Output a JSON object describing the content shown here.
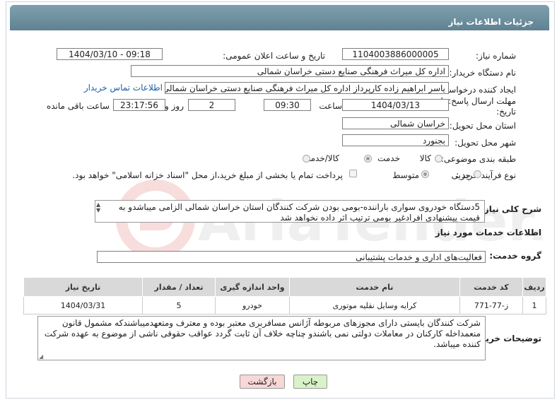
{
  "header": {
    "title": "جزئیات اطلاعات نیاز"
  },
  "form": {
    "need_number_label": "شماره نیاز:",
    "need_number": "1104003886000005",
    "announce_label": "تاریخ و ساعت اعلان عمومی:",
    "announce_value": "1404/03/10 - 09:18",
    "buyer_org_label": "نام دستگاه خریدار:",
    "buyer_org": "اداره کل میراث فرهنگی صنایع دستی خراسان شمالی",
    "creator_label": "ایجاد کننده درخواست:",
    "creator": "یاسر ابراهیم زاده کارپرداز اداره کل میراث فرهنگی صنایع دستی خراسان شمالی",
    "contact_link": "اطلاعات تماس خریدار",
    "deadline_label_1": "مهلت ارسال پاسخ: تا",
    "deadline_label_2": "تاریخ:",
    "deadline_date": "1404/03/13",
    "time_label": "ساعت",
    "deadline_time": "09:30",
    "days_value": "2",
    "days_label": "روز و",
    "remaining_time": "23:17:56",
    "remaining_label": "ساعت باقی مانده",
    "province_label": "استان محل تحویل:",
    "province": "خراسان شمالی",
    "city_label": "شهر محل تحویل:",
    "city": "بجنورد",
    "category_label": "طبقه بندی موضوعی:",
    "category_options": [
      "کالا",
      "خدمت",
      "کالا/خدمت"
    ],
    "category_selected": "خدمت",
    "process_label": "نوع فرآیند خرید :",
    "process_options": [
      "جزیی",
      "متوسط"
    ],
    "process_selected": "متوسط",
    "payment_note": "پرداخت تمام یا بخشی از مبلغ خرید،از محل \"اسناد خزانه اسلامی\" خواهد بود."
  },
  "description": {
    "label": "شرح کلی نیاز:",
    "text": "5دستگاه خودروی سواری باراننده-بومی بودن شرکت کنندگان استان خراسان شمالی الزامی میباشدو به قیمت پیشنهادی افرادغیر بومی ترتیب اثر داده نخواهد شد"
  },
  "services": {
    "section_title": "اطلاعات خدمات مورد نیاز",
    "group_label": "گروه خدمت:",
    "group_value": "فعالیت‌های اداری و خدمات پشتیبانی",
    "columns": [
      "ردیف",
      "کد خدمت",
      "نام خدمت",
      "واحد اندازه گیری",
      "تعداد / مقدار",
      "تاریخ نیاز"
    ],
    "rows": [
      [
        "1",
        "ز-77-771",
        "کرایه وسایل نقلیه موتوری",
        "خودرو",
        "5",
        "1404/03/31"
      ]
    ]
  },
  "buyer_notes": {
    "label": "توضیحات خریدار:",
    "text": "شرکت کنندگان بایستی دارای مجوزهای مربوطه آژانس مسافربری معتبر بوده و معترف ومتعهدمیباشندکه مشمول قانون منعمداخله کارکنان در معاملات دولتی نمی باشندو چناچه خلاف آن ثابت گردد عواقب حقوقی ناشی از موضوع به عهده شرکت کننده میباشد."
  },
  "buttons": {
    "print": "چاپ",
    "back": "بازگشت"
  },
  "colors": {
    "header": "#6f92a2",
    "link": "#1b5fa8",
    "print_btn": "#d9f2c9",
    "back_btn": "#f8d7d7"
  }
}
